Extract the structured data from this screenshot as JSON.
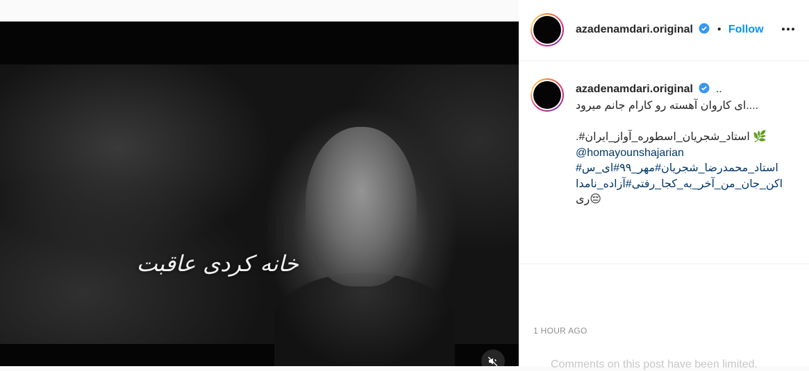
{
  "post": {
    "username": "azadenamdari.original",
    "follow_label": "Follow",
    "separator": "•",
    "video_overlay_text": "خانه کردی عاقبت",
    "caption": {
      "username": "azadenamdari.original",
      "lines": [
        "....ای کاروان آهسته رو کارام جانم میرود",
        "",
        "🌿 استاد_شجریان_اسطوره_آواز_ایران#.",
        "@homayounshajarian",
        "استاد_محمدرضا_شجریان#مهر_۹۹#ای_س#",
        "اکن_جان_من_آخر_به_کجا_رفتی#آزاده_نامدا",
        "😔ری"
      ],
      "mention": "@homayounshajarian"
    },
    "timestamp": "1 HOUR AGO",
    "comments_notice": "Comments on this post have been limited."
  },
  "icons": {
    "verified": "verified-badge-icon",
    "more": "more-options-icon",
    "mute": "muted-speaker-icon"
  },
  "colors": {
    "accent": "#0095f6",
    "verified": "#3897f0",
    "text": "#262626",
    "muted": "#8e8e8e",
    "link": "#00376b"
  }
}
